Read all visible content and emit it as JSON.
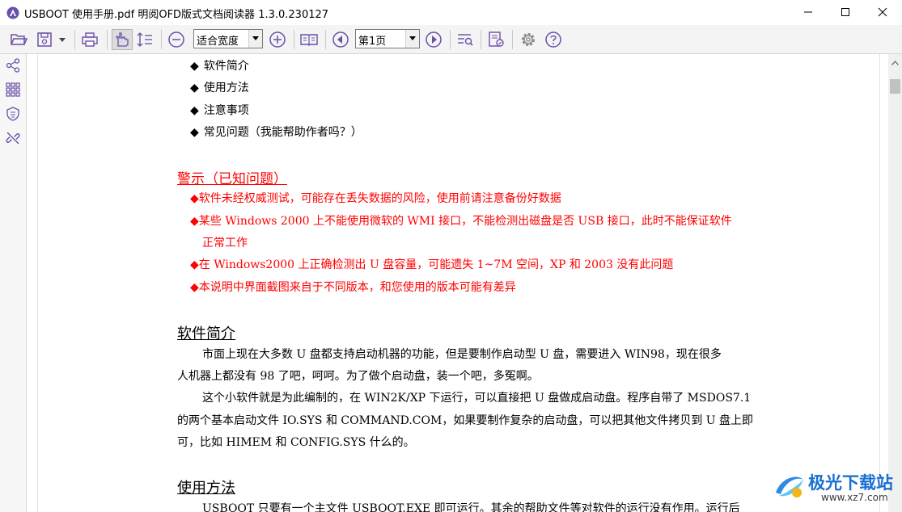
{
  "window": {
    "title": "USBOOT 使用手册.pdf 明阅OFD版式文档阅读器 1.3.0.230127",
    "controls": [
      "minimize-icon",
      "maximize-icon",
      "close-icon"
    ]
  },
  "toolbar": {
    "icons": [
      "open-folder-icon",
      "save-icon",
      "dropdown-arrow-icon",
      "print-icon",
      "hand-tool-icon",
      "text-select-icon",
      "zoom-out-icon",
      "zoom-in-icon",
      "book-view-icon",
      "prev-page-icon",
      "next-page-icon",
      "search-icon",
      "certificate-icon",
      "settings-icon",
      "help-icon"
    ],
    "zoom_value": "适合宽度",
    "page_value": "第1页"
  },
  "sidebar": {
    "icons": [
      "share-icon",
      "thumbnails-icon",
      "certificate-icon",
      "link-icon"
    ]
  },
  "document": {
    "toc": [
      "软件简介",
      "使用方法",
      "注意事项",
      "常见问题（我能帮助作者吗？）"
    ],
    "warning_heading": "警示（已知问题）",
    "warnings": [
      "软件未经权威测试，可能存在丢失数据的风险，使用前请注意备份好数据",
      "某些 Windows 2000 上不能使用微软的 WMI 接口，不能检测出磁盘是否 USB 接口，此时不能保证软件",
      "正常工作",
      "在 Windows2000 上正确检测出 U 盘容量，可能遗失 1~7M 空间，XP 和 2003 没有此问题",
      "本说明中界面截图来自于不同版本，和您使用的版本可能有差异"
    ],
    "intro_heading": "软件简介",
    "intro_paragraphs": [
      "市面上现在大多数 U 盘都支持启动机器的功能，但是要制作启动型 U 盘，需要进入 WIN98，现在很多",
      "人机器上都没有 98 了吧，呵呵。为了做个启动盘，装一个吧，多冤啊。",
      "这个小软件就是为此编制的，在 WIN2K/XP 下运行，可以直接把 U 盘做成启动盘。程序自带了 MSDOS7.1",
      "的两个基本启动文件 IO.SYS 和 COMMAND.COM，如果要制作复杂的启动盘，可以把其他文件拷贝到 U 盘上即",
      "可，比如 HIMEM 和 CONFIG.SYS 什么的。"
    ],
    "usage_heading": "使用方法",
    "usage_paragraph": "USBOOT 只要有一个主文件 USBOOT.EXE 即可运行。其余的帮助文件等对软件的运行没有作用。运行后"
  },
  "watermark": {
    "text": "极光下载站",
    "url": "www.xz7.com"
  },
  "colors": {
    "accent": "#6b4fa8",
    "warning": "#ff0000",
    "watermark": "#1a6fd0"
  }
}
